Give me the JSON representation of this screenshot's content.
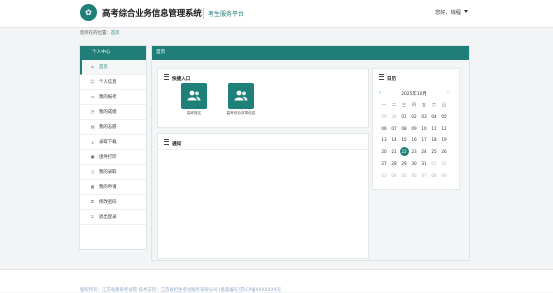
{
  "header": {
    "logo_glyph": "✿",
    "title": "高考综合业务信息管理系统",
    "subtitle": "考生服务平台",
    "user_greeting": "您好，钱程"
  },
  "breadcrumb": {
    "prefix": "您所在的位置：",
    "current": "首页"
  },
  "sidebar": {
    "title": "个人中心",
    "items": [
      {
        "label": "首页",
        "icon": "home-icon",
        "glyph": "⌂"
      },
      {
        "label": "个人信息",
        "icon": "user-icon",
        "glyph": "☺"
      },
      {
        "label": "我的报考",
        "icon": "card-icon",
        "glyph": "▭"
      },
      {
        "label": "我的成绩",
        "icon": "clock-icon",
        "glyph": "◷"
      },
      {
        "label": "我的志愿",
        "icon": "doc-icon",
        "glyph": "▤"
      },
      {
        "label": "录取下载",
        "icon": "download-icon",
        "glyph": "⤓"
      },
      {
        "label": "函件打印",
        "icon": "print-icon",
        "glyph": "▣"
      },
      {
        "label": "我的录取",
        "icon": "file-icon",
        "glyph": "▯"
      },
      {
        "label": "我的申请",
        "icon": "apply-icon",
        "glyph": "▦"
      },
      {
        "label": "修改密码",
        "icon": "lock-icon",
        "glyph": "⚿"
      },
      {
        "label": "退出登录",
        "icon": "logout-icon",
        "glyph": "⎋"
      }
    ]
  },
  "main": {
    "title": "首页",
    "quick_entry": {
      "title": "快捷入口",
      "items": [
        {
          "label": "高考报名"
        },
        {
          "label": "高考综合改革信息"
        }
      ]
    },
    "notice": {
      "title": "通知"
    },
    "calendar": {
      "title": "日历",
      "month_label": "2025年10月",
      "weekdays": [
        "一",
        "二",
        "三",
        "四",
        "五",
        "六",
        "日"
      ],
      "weeks": [
        [
          {
            "d": "29",
            "dim": true
          },
          {
            "d": "30",
            "dim": true
          },
          {
            "d": "01"
          },
          {
            "d": "02"
          },
          {
            "d": "03"
          },
          {
            "d": "04"
          },
          {
            "d": "05"
          }
        ],
        [
          {
            "d": "06"
          },
          {
            "d": "07"
          },
          {
            "d": "08"
          },
          {
            "d": "09"
          },
          {
            "d": "10"
          },
          {
            "d": "11"
          },
          {
            "d": "12"
          }
        ],
        [
          {
            "d": "13"
          },
          {
            "d": "14"
          },
          {
            "d": "15"
          },
          {
            "d": "16"
          },
          {
            "d": "17"
          },
          {
            "d": "18"
          },
          {
            "d": "19"
          }
        ],
        [
          {
            "d": "20"
          },
          {
            "d": "21"
          },
          {
            "d": "22",
            "today": true
          },
          {
            "d": "23"
          },
          {
            "d": "24"
          },
          {
            "d": "25"
          },
          {
            "d": "26"
          }
        ],
        [
          {
            "d": "27"
          },
          {
            "d": "28"
          },
          {
            "d": "29"
          },
          {
            "d": "30"
          },
          {
            "d": "31"
          },
          {
            "d": "01",
            "dim": true
          },
          {
            "d": "02",
            "dim": true
          }
        ],
        [
          {
            "d": "03",
            "dim": true
          },
          {
            "d": "04",
            "dim": true
          },
          {
            "d": "05",
            "dim": true
          },
          {
            "d": "06",
            "dim": true
          },
          {
            "d": "07",
            "dim": true
          },
          {
            "d": "08",
            "dim": true
          },
          {
            "d": "09",
            "dim": true
          }
        ]
      ]
    }
  },
  "footer": {
    "text": "版权所有：江苏省教育考试院  技术支持：江苏省招生考试服务有限公司  [备案编号]苏ICP备XXXXXXX号"
  },
  "colors": {
    "accent": "#1f7f78",
    "background": "#f2f4f5"
  }
}
